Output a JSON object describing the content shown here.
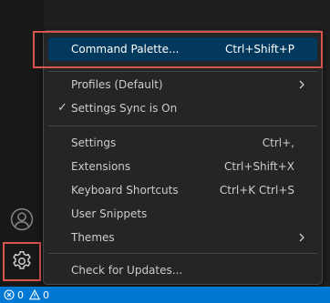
{
  "menu": {
    "items": [
      {
        "label": "Command Palette...",
        "shortcut": "Ctrl+Shift+P"
      },
      {
        "label": "Profiles (Default)",
        "shortcut": ""
      },
      {
        "label": "Settings Sync is On",
        "shortcut": "",
        "check": "✓"
      },
      {
        "label": "Settings",
        "shortcut": "Ctrl+,"
      },
      {
        "label": "Extensions",
        "shortcut": "Ctrl+Shift+X"
      },
      {
        "label": "Keyboard Shortcuts",
        "shortcut": "Ctrl+K Ctrl+S"
      },
      {
        "label": "User Snippets",
        "shortcut": ""
      },
      {
        "label": "Themes",
        "shortcut": ""
      },
      {
        "label": "Check for Updates...",
        "shortcut": ""
      }
    ]
  },
  "activity_bar": {
    "accounts_icon": "account-icon",
    "manage_icon": "gear-icon"
  },
  "statusbar": {
    "errors": "0",
    "warnings": "0"
  },
  "colors": {
    "statusbar": "#0078d4",
    "selected_item": "#04395e",
    "highlight": "#d9534f"
  }
}
